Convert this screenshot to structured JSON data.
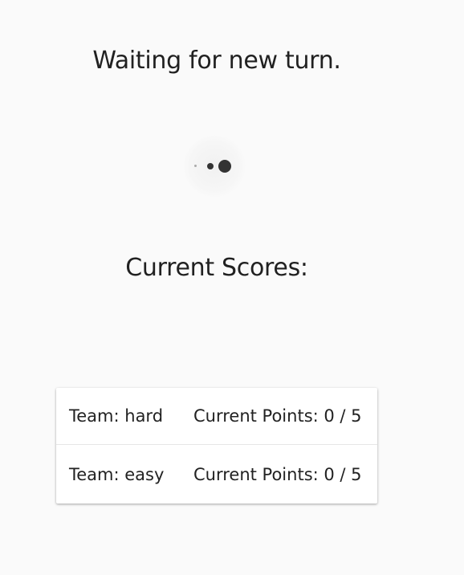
{
  "status": {
    "title": "Waiting for new turn."
  },
  "scores": {
    "title": "Current Scores:",
    "rows": [
      {
        "team": "Team: hard",
        "points": "Current Points: 0 / 5"
      },
      {
        "team": "Team: easy",
        "points": "Current Points: 0 / 5"
      }
    ]
  }
}
